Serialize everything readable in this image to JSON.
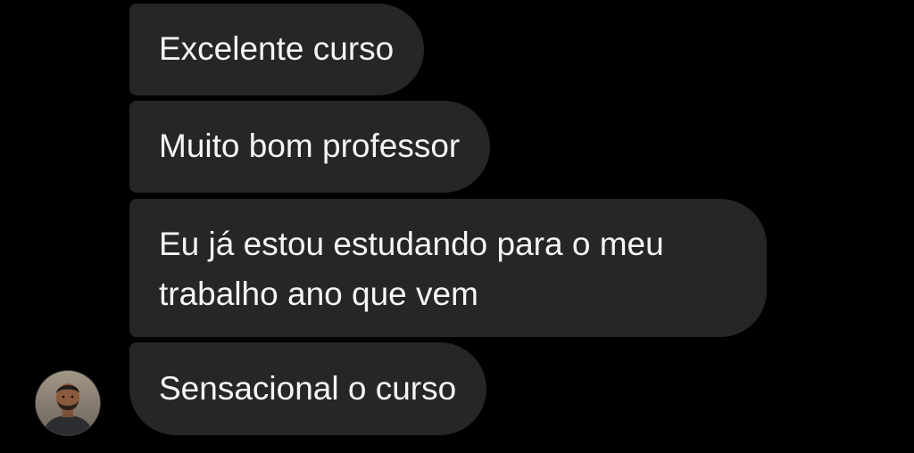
{
  "messages": [
    {
      "text": "Excelente curso"
    },
    {
      "text": "Muito bom professor"
    },
    {
      "text": "Eu já estou estudando para o meu trabalho ano que vem"
    },
    {
      "text": "Sensacional o curso"
    }
  ],
  "colors": {
    "background": "#000000",
    "bubble": "#262626",
    "text": "#f5f5f5"
  },
  "avatar": {
    "icon": "person-photo-avatar"
  }
}
